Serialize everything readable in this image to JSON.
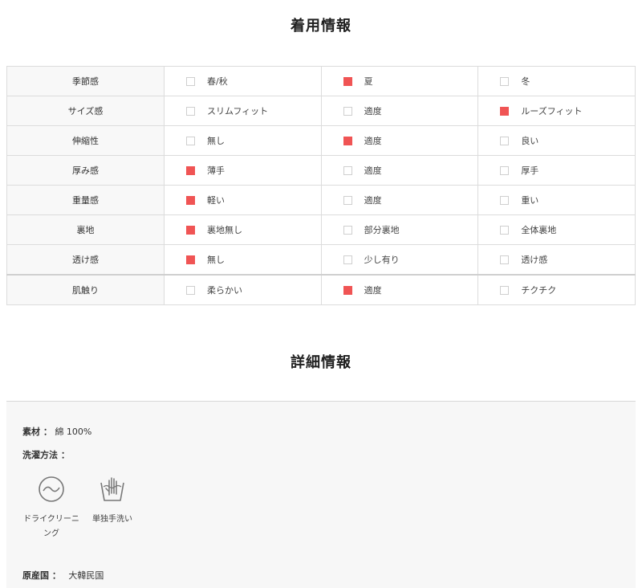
{
  "wear_section": {
    "title": "着用情報",
    "rows": [
      {
        "label": "季節感",
        "options": [
          {
            "text": "春/秋",
            "checked": false
          },
          {
            "text": "夏",
            "checked": true
          },
          {
            "text": "冬",
            "checked": false
          }
        ]
      },
      {
        "label": "サイズ感",
        "options": [
          {
            "text": "スリムフィット",
            "checked": false
          },
          {
            "text": "適度",
            "checked": false
          },
          {
            "text": "ルーズフィット",
            "checked": true
          }
        ]
      },
      {
        "label": "伸縮性",
        "options": [
          {
            "text": "無し",
            "checked": false
          },
          {
            "text": "適度",
            "checked": true
          },
          {
            "text": "良い",
            "checked": false
          }
        ]
      },
      {
        "label": "厚み感",
        "options": [
          {
            "text": "薄手",
            "checked": true
          },
          {
            "text": "適度",
            "checked": false
          },
          {
            "text": "厚手",
            "checked": false
          }
        ]
      },
      {
        "label": "重量感",
        "options": [
          {
            "text": "軽い",
            "checked": true
          },
          {
            "text": "適度",
            "checked": false
          },
          {
            "text": "重い",
            "checked": false
          }
        ]
      },
      {
        "label": "裏地",
        "options": [
          {
            "text": "裏地無し",
            "checked": true
          },
          {
            "text": "部分裏地",
            "checked": false
          },
          {
            "text": "全体裏地",
            "checked": false
          }
        ]
      },
      {
        "label": "透け感",
        "options": [
          {
            "text": "無し",
            "checked": true
          },
          {
            "text": "少し有り",
            "checked": false
          },
          {
            "text": "透け感",
            "checked": false
          }
        ]
      },
      {
        "label": "肌触り",
        "options": [
          {
            "text": "柔らかい",
            "checked": false
          },
          {
            "text": "適度",
            "checked": true
          },
          {
            "text": "チクチク",
            "checked": false
          }
        ]
      }
    ]
  },
  "detail_section": {
    "title": "詳細情報",
    "material_label": "素材 ：",
    "material_value": "綿 100%",
    "wash_label": "洗濯方法 ：",
    "care_items": [
      {
        "icon": "dry-clean-icon",
        "label": "ドライクリーニング"
      },
      {
        "icon": "hand-wash-icon",
        "label": "単独手洗い"
      }
    ],
    "origin_label": "原産国 ：",
    "origin_value": "大韓民国"
  },
  "colors": {
    "checked": "#f05454",
    "unchecked_border": "#cfcfcf",
    "label_bg": "#f8f8f8",
    "detail_bg": "#f7f7f7"
  }
}
